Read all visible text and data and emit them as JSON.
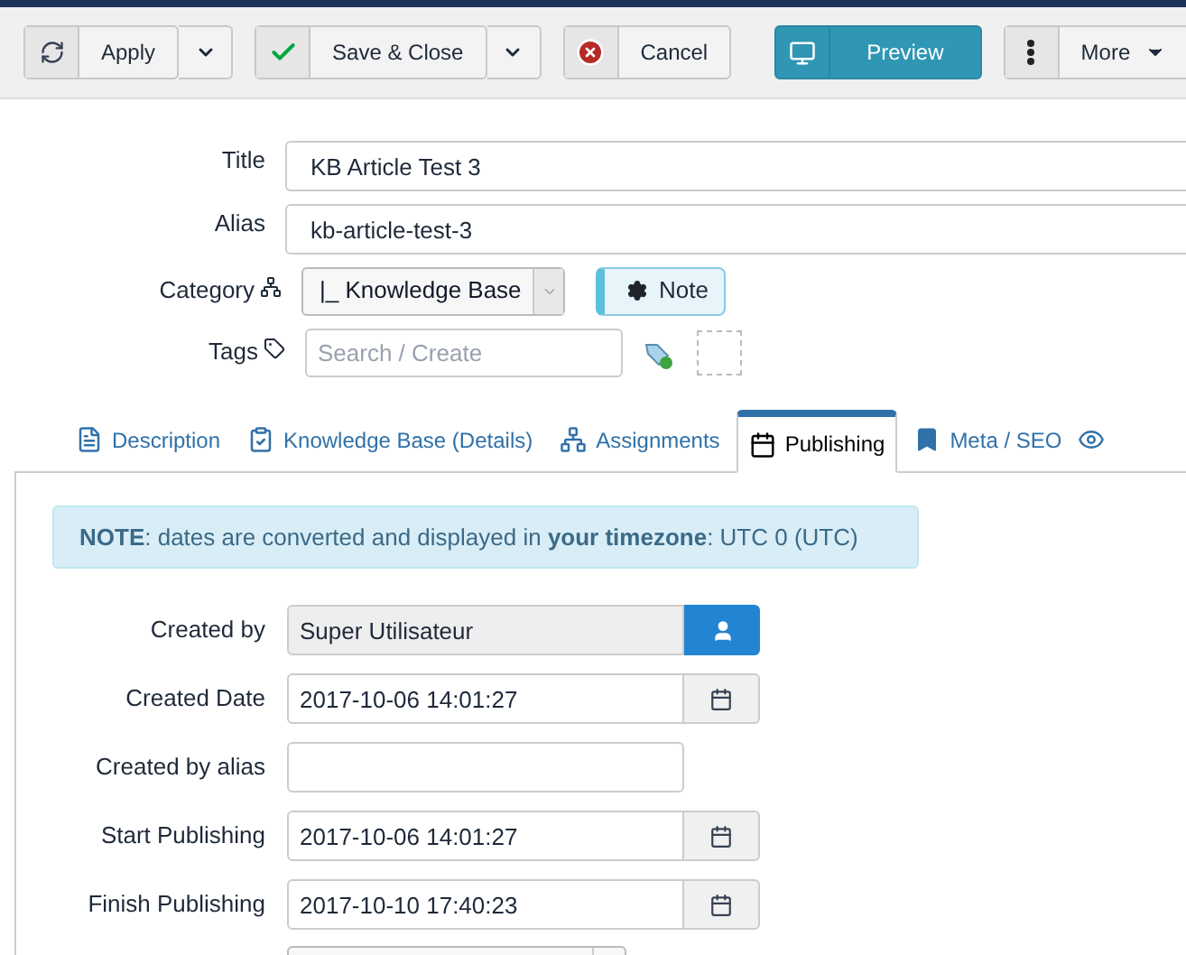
{
  "toolbar": [
    {
      "kind": "split",
      "label": "Apply"
    },
    {
      "kind": "split",
      "label": "Save & Close"
    },
    {
      "kind": "plain",
      "label": "Cancel"
    },
    {
      "kind": "primary",
      "label": "Preview"
    },
    {
      "kind": "menu",
      "label": "More"
    }
  ],
  "header_fields": [
    {
      "label": "Title",
      "value": "KB Article Test 3"
    },
    {
      "label": "Alias",
      "value": "kb-article-test-3"
    }
  ],
  "category": {
    "label": "Category",
    "value": "|_ Knowledge Base",
    "note_button": "Note"
  },
  "tags": {
    "label": "Tags",
    "placeholder": "Search / Create"
  },
  "tabs": [
    {
      "label": "Description",
      "selected": false
    },
    {
      "label": "Knowledge Base (Details)",
      "selected": false
    },
    {
      "label": "Assignments",
      "selected": false
    },
    {
      "label": "Publishing",
      "selected": true
    },
    {
      "label": "Meta / SEO",
      "selected": false
    }
  ],
  "notice": "**NOTE**: dates are converted and displayed in **your timezone**: UTC 0 (UTC)",
  "publishing_fields": [
    {
      "kind": "user",
      "label": "Created by",
      "value": "Super Utilisateur"
    },
    {
      "kind": "date",
      "label": "Created Date",
      "value": "2017-10-06 14:01:27"
    },
    {
      "kind": "text",
      "label": "Created by alias"
    },
    {
      "kind": "date",
      "label": "Start Publishing",
      "value": "2017-10-06 14:01:27"
    },
    {
      "kind": "date",
      "label": "Finish Publishing",
      "value": "2017-10-10 17:40:23"
    }
  ]
}
